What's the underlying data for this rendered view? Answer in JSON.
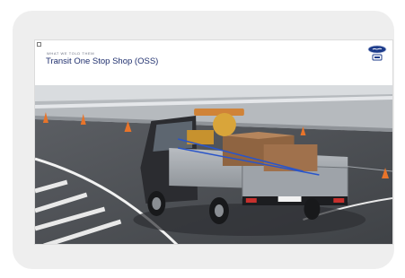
{
  "slide": {
    "kicker": "WHAT WE TOLD THEM",
    "title": "Transit One Stop Shop (OSS)"
  },
  "logo": {
    "icon": "ford-logo-icon"
  },
  "hero": {
    "icon": "transit-truck-photo"
  },
  "colors": {
    "title": "#1f2f6e",
    "kicker": "#6a6f80",
    "card": "#eeeeee",
    "road": "#4a4d52",
    "truck_body": "#2b2c30",
    "bed": "#9ea3a9",
    "cone": "#e8742a",
    "brand_blue": "#1c3b8a"
  }
}
